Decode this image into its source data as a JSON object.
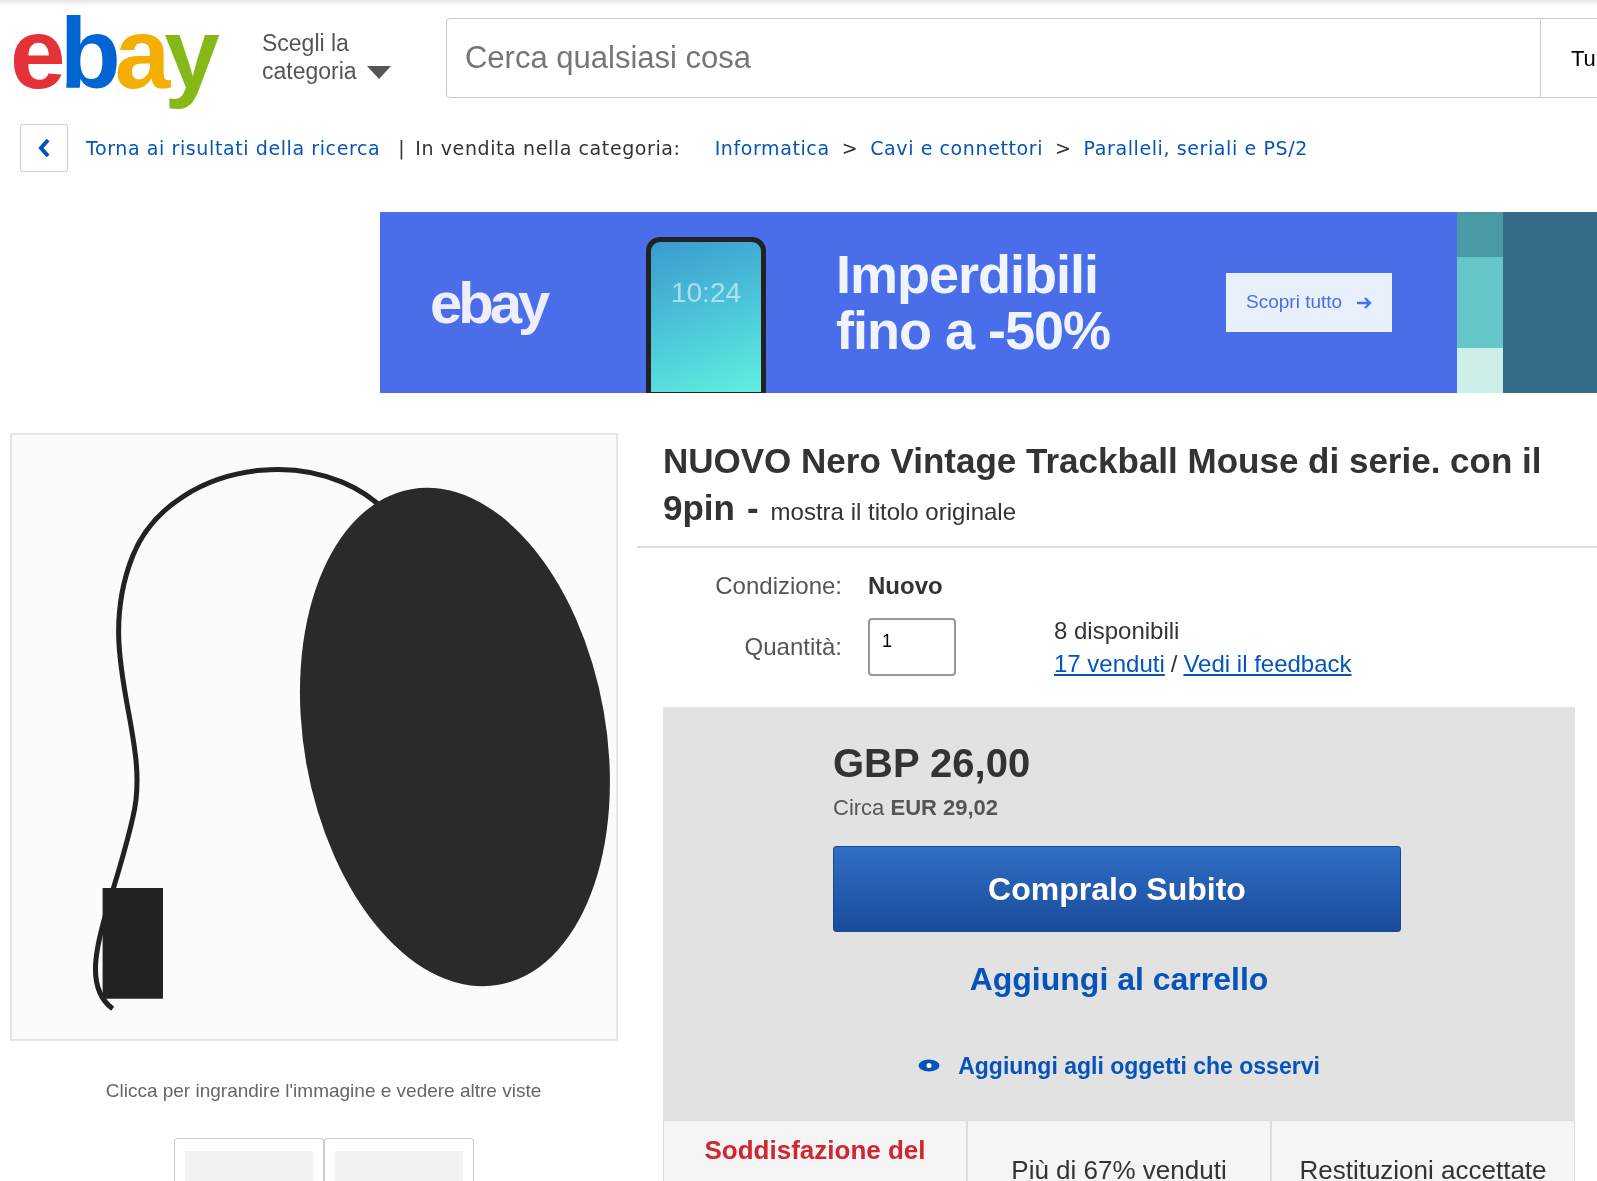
{
  "header": {
    "logo": "ebay",
    "category_picker": "Scegli la categoria",
    "search": {
      "placeholder": "Cerca qualsiasi cosa"
    },
    "category_dropdown": "Tu"
  },
  "breadcrumb": {
    "back_link": "Torna ai risultati della ricerca",
    "divider": "|",
    "label": "In vendita nella categoria:",
    "items": [
      {
        "label": "Informatica"
      },
      {
        "separator": ">",
        "label": "Cavi e connettori"
      },
      {
        "separator": ">",
        "label": "Paralleli, seriali e PS/2"
      }
    ]
  },
  "banner": {
    "logo": "ebay",
    "phone_time": "10:24",
    "headline": [
      "Imperdibili",
      "fino a -50%"
    ],
    "button": "Scopri tutto"
  },
  "gallery": {
    "caption": "Clicca per ingrandire l'immagine e vedere altre viste"
  },
  "listing": {
    "title_lines": [
      "NUOVO Nero Vintage Trackball Mouse di serie. con il",
      "9pin"
    ],
    "title_dash": "-",
    "original_title_link": "mostra il titolo originale",
    "condition_label": "Condizione:",
    "condition": "Nuovo",
    "quantity_label": "Quantità:",
    "quantity": "1",
    "available": "8 disponibili",
    "sold_link": "17 venduti",
    "link_divider": "/",
    "feedback_link": "Vedi il feedback"
  },
  "buy_box": {
    "price": "GBP 26,00",
    "approx": "Circa **EUR 29,02**",
    "buy_button": "Compralo Subito",
    "cart_button": "Aggiungi al carrello",
    "watch_link": "Aggiungi agli oggetti che osservi",
    "badges": [
      {
        "kind": "highlight",
        "text": "Soddisfazione del"
      },
      {
        "kind": "plain",
        "text": "Più di 67% venduti"
      },
      {
        "kind": "plain",
        "text": "Restituzioni accettate"
      }
    ]
  }
}
